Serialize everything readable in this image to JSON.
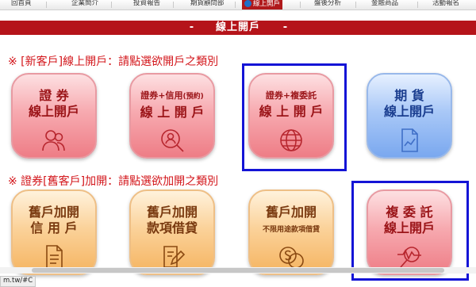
{
  "nav": {
    "items": [
      {
        "label": "回首頁"
      },
      {
        "label": "企業簡介"
      },
      {
        "label": "投資報告"
      },
      {
        "label": "期貨顧問部"
      },
      {
        "label": "線上開戶",
        "active": true
      },
      {
        "label": "盤後分析"
      },
      {
        "label": "金融商品"
      },
      {
        "label": "活動報名"
      }
    ],
    "active_color": "#b0191b"
  },
  "banner": {
    "dash_left": "-",
    "title": "線上開戶",
    "dash_right": "-",
    "color": "#b5141a"
  },
  "new_section": {
    "heading": "※ [新客戶]線上開戶：請點選欲開戶之類別"
  },
  "existing_section": {
    "heading": "※ 證券[舊客戶]加開：請點選欲加開之類別"
  },
  "tiles_new": [
    {
      "line1": "證 券",
      "line2": "線上開戶",
      "icon": "users-icon"
    },
    {
      "line1": "證券+信用",
      "line1_note": "(預約)",
      "line2": "線 上 開 戶",
      "icon": "search-person-icon"
    },
    {
      "line1": "證券+複委託",
      "line2": "線 上 開 戶",
      "icon": "globe-icon"
    },
    {
      "line1": "期 貨",
      "line2": "線上開戶",
      "icon": "chart-document-icon"
    }
  ],
  "tiles_existing": [
    {
      "line1": "舊戶加開",
      "line2": "信 用 戶",
      "icon": "document-list-icon"
    },
    {
      "line1": "舊戶加開",
      "line2": "款項借貸",
      "icon": "document-edit-icon"
    },
    {
      "line1": "舊戶加開",
      "line2": "不限用途款項借貸",
      "icon": "coins-icon"
    },
    {
      "line1": "複 委 託",
      "line2": "線上開戶",
      "icon": "magnifier-chart-icon"
    }
  ],
  "colors": {
    "heading": "#d3161b",
    "highlight": "#1414d6",
    "red_tile": "#ee7d86",
    "blue_tile": "#7aa8ef",
    "orange_tile": "#f5b461"
  },
  "status": {
    "url": "m.tw/#C"
  }
}
